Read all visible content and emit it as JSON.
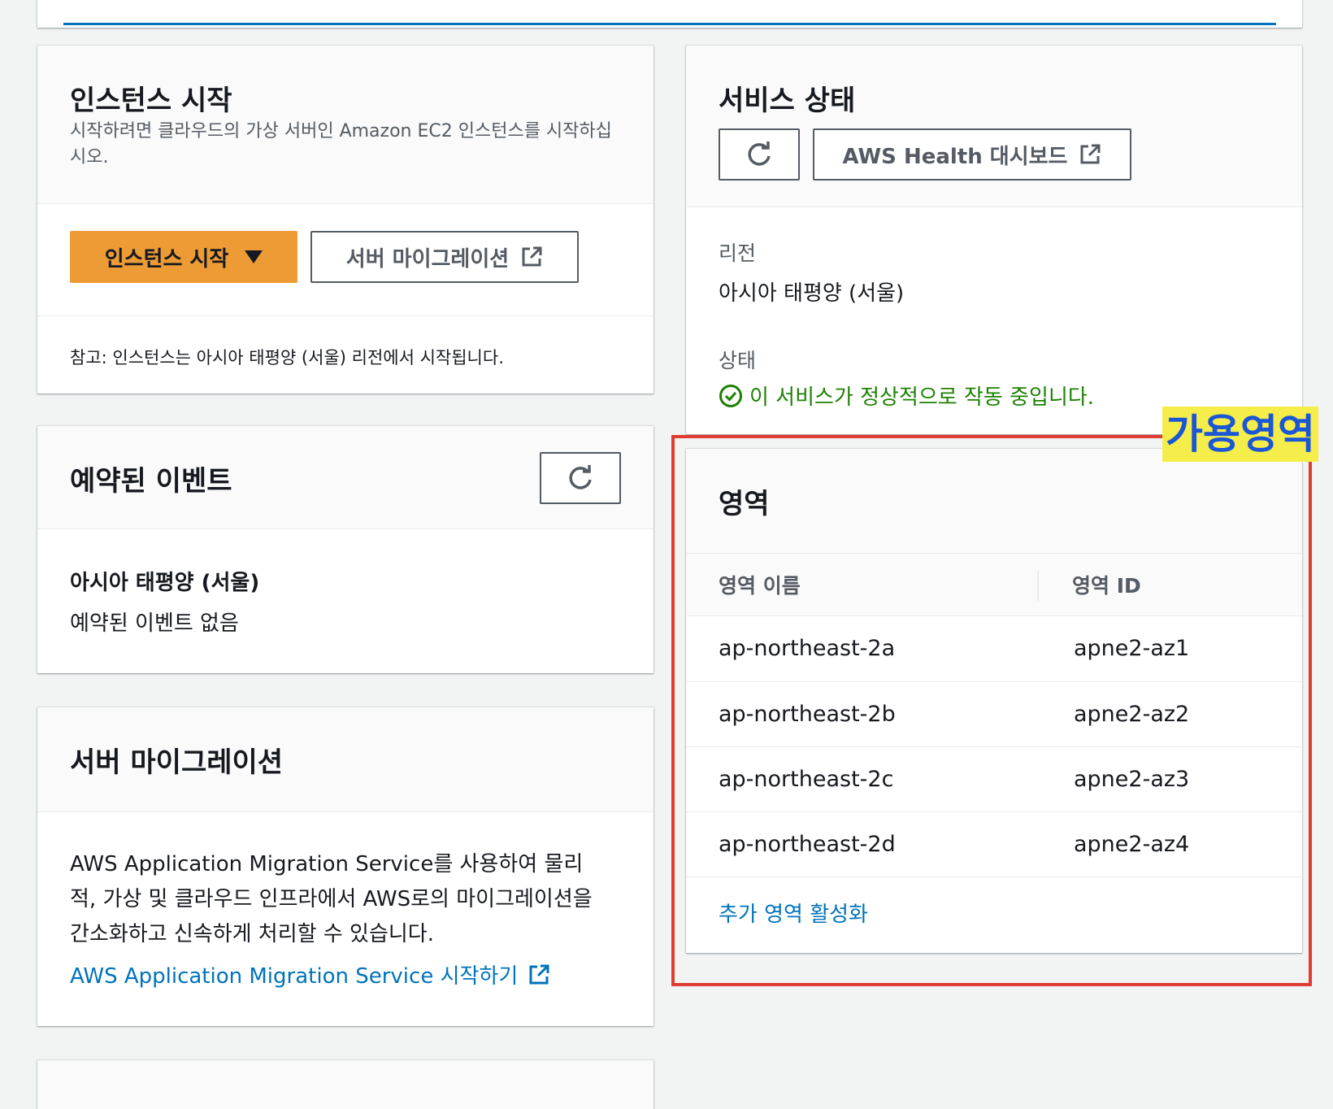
{
  "launch": {
    "title": "인스턴스 시작",
    "description": "시작하려면 클라우드의 가상 서버인 Amazon EC2 인스턴스를 시작하십시오.",
    "launch_button": "인스턴스 시작",
    "migration_button": "서버 마이그레이션",
    "note": "참고: 인스턴스는 아시아 태평양 (서울) 리전에서 시작됩니다."
  },
  "events": {
    "title": "예약된 이벤트",
    "region": "아시아 태평양 (서울)",
    "empty": "예약된 이벤트 없음"
  },
  "migration": {
    "title": "서버 마이그레이션",
    "body": "AWS Application Migration Service를 사용하여 물리적, 가상 및 클라우드 인프라에서 AWS로의 마이그레이션을 간소화하고 신속하게 처리할 수 있습니다.",
    "link": "AWS Application Migration Service 시작하기"
  },
  "service_health": {
    "title": "서비스 상태",
    "dashboard_button": "AWS Health 대시보드",
    "region_label": "리전",
    "region_value": "아시아 태평양 (서울)",
    "status_label": "상태",
    "status_value": "이 서비스가 정상적으로 작동 중입니다.",
    "status_color": "#1d8102"
  },
  "zones": {
    "title": "영역",
    "columns": [
      "영역 이름",
      "영역 ID"
    ],
    "rows": [
      {
        "name": "ap-northeast-2a",
        "id": "apne2-az1"
      },
      {
        "name": "ap-northeast-2b",
        "id": "apne2-az2"
      },
      {
        "name": "ap-northeast-2c",
        "id": "apne2-az3"
      },
      {
        "name": "ap-northeast-2d",
        "id": "apne2-az4"
      }
    ],
    "enable_link": "추가 영역 활성화"
  },
  "annotation": {
    "label": "가용영역",
    "box_color": "#e03c31",
    "label_bg": "#f5ee4a",
    "label_color": "#1a56d6"
  }
}
